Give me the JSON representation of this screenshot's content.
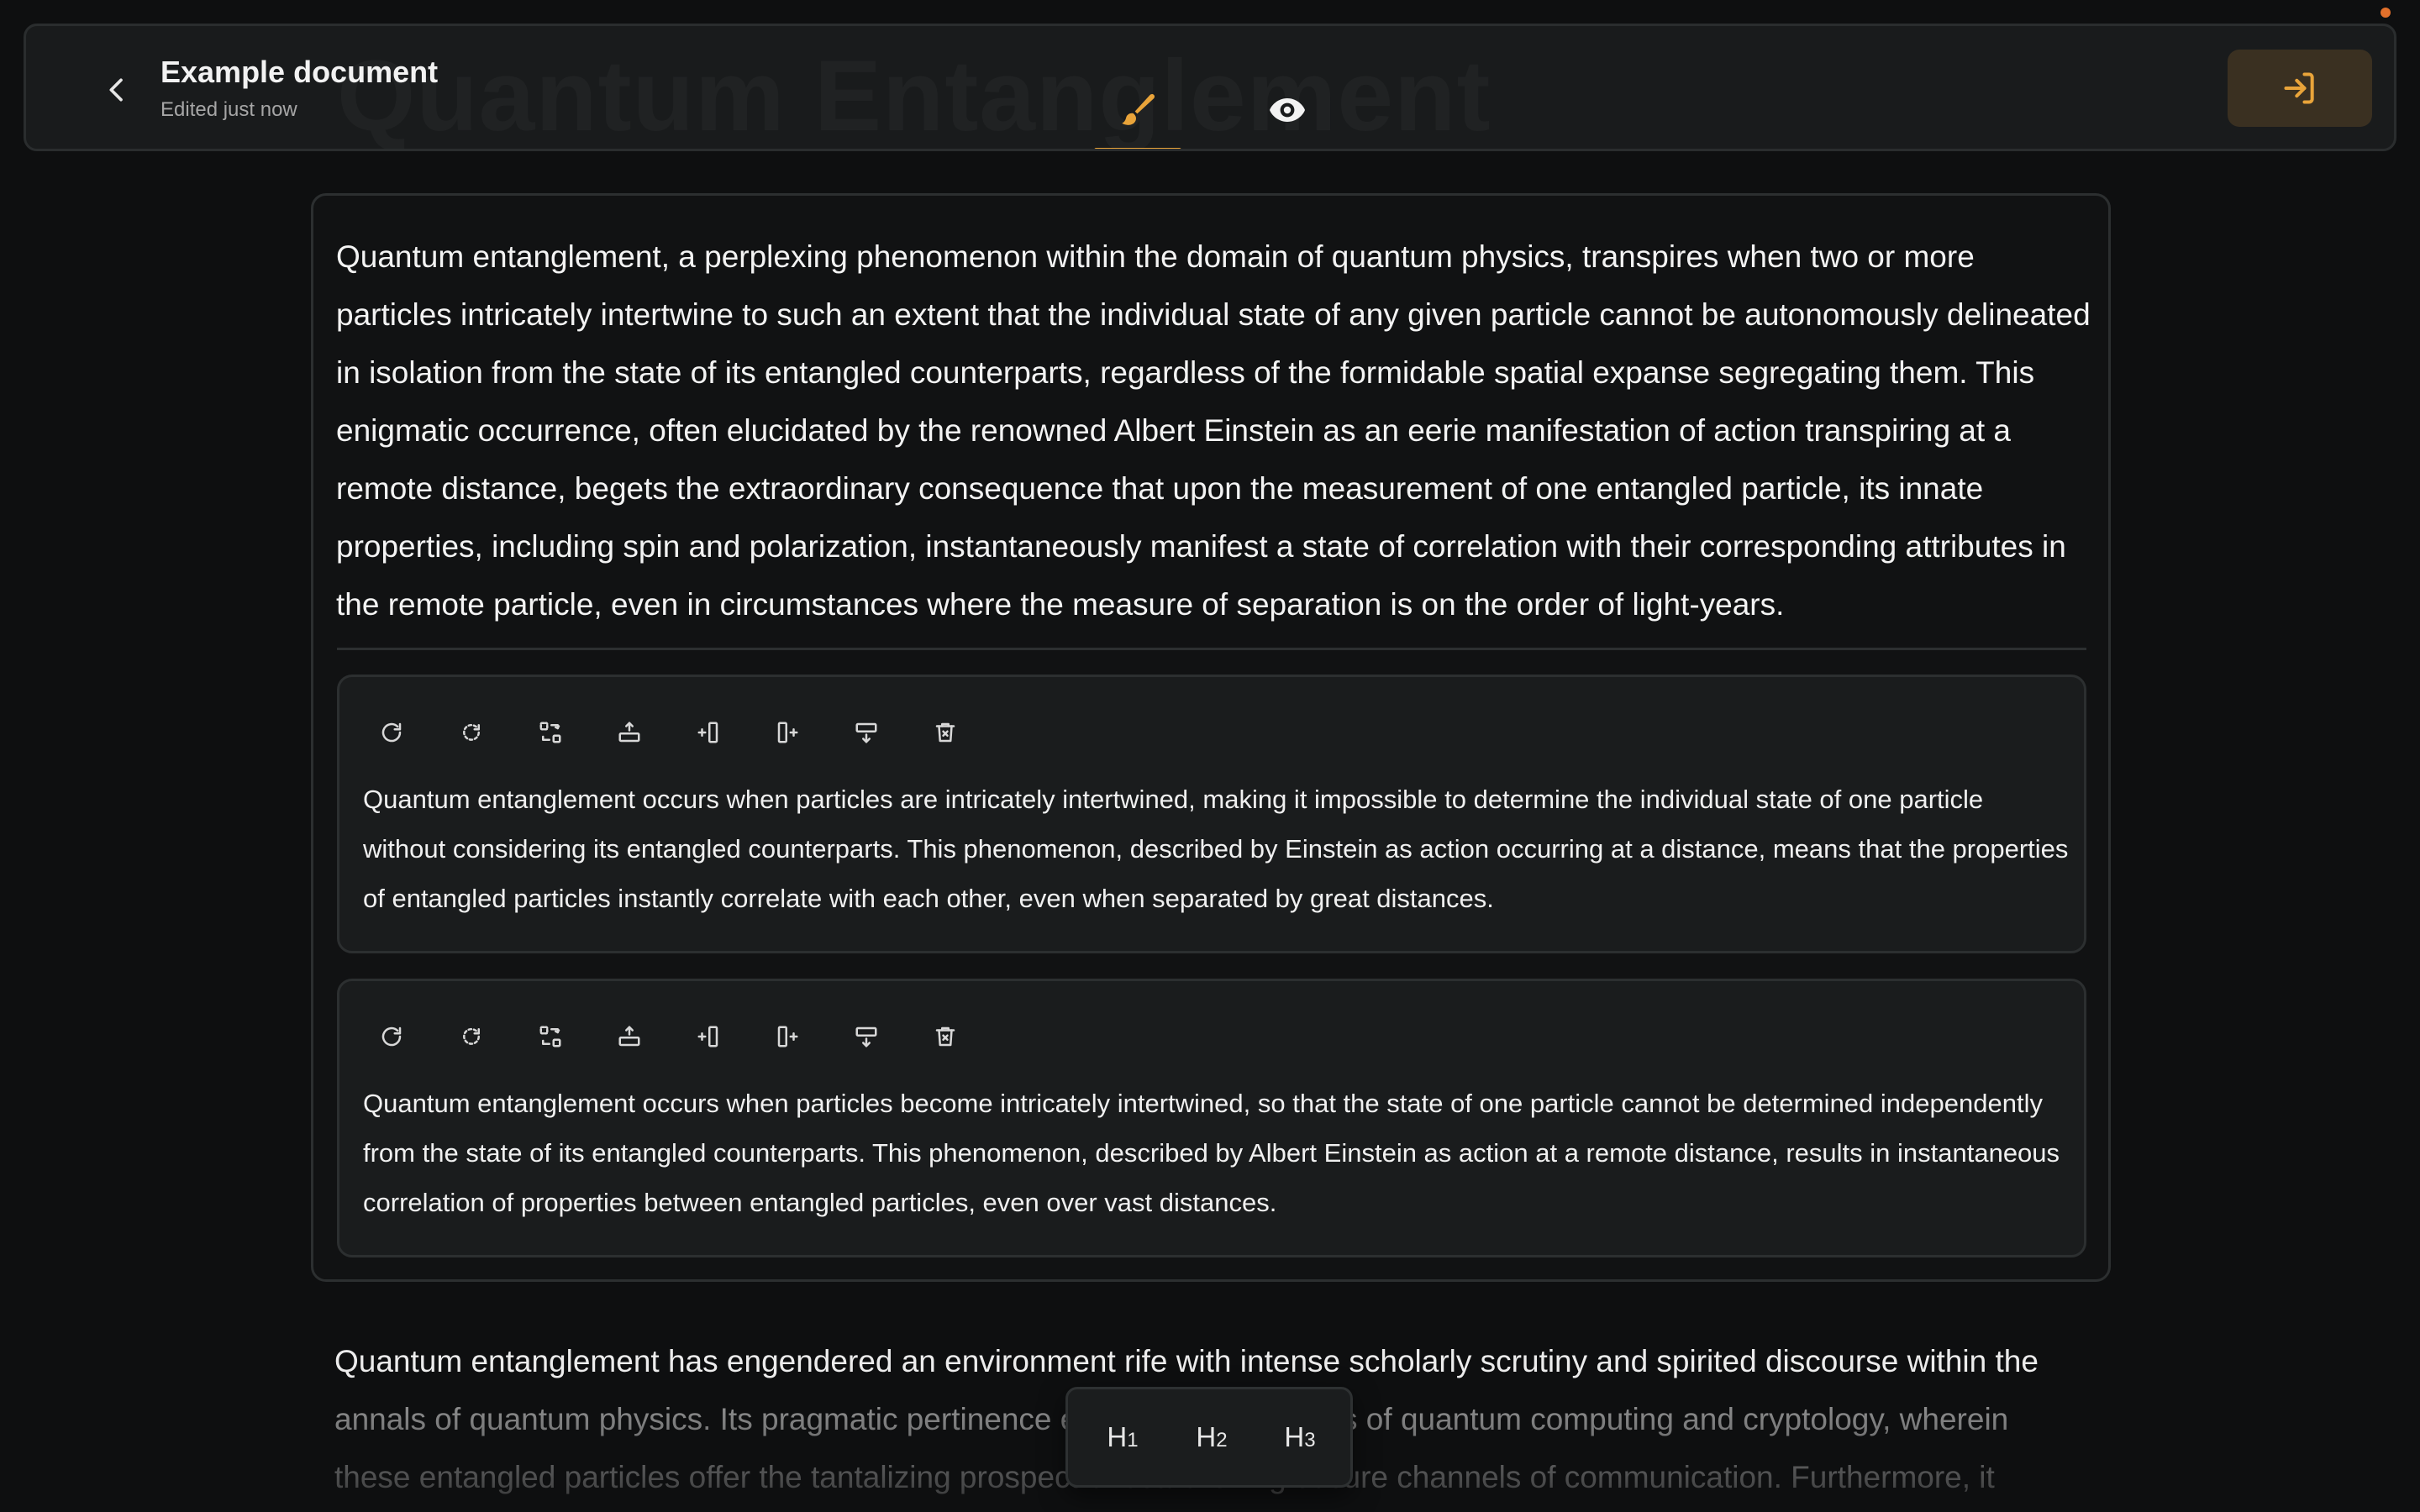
{
  "header": {
    "ghost_title": "Quantum Entanglement",
    "doc_title": "Example document",
    "doc_status": "Edited just now"
  },
  "main": {
    "paragraph": "Quantum entanglement, a perplexing phenomenon within the domain of quantum physics, transpires when two or more particles intricately intertwine to such an extent that the individual state of any given particle cannot be autonomously delineated in isolation from the state of its entangled counterparts, regardless of the formidable spatial expanse segregating them. This enigmatic occurrence, often elucidated by the renowned Albert Einstein as an eerie manifestation of action transpiring at a remote distance, begets the extraordinary consequence that upon the measurement of one entangled particle, its innate properties, including spin and polarization, instantaneously manifest a state of correlation with their corresponding attributes in the remote particle, even in circumstances where the measure of separation is on the order of light-years.",
    "suggestions": [
      {
        "text": "Quantum entanglement occurs when particles are intricately intertwined, making it impossible to determine the individual state of one particle without considering its entangled counterparts. This phenomenon, described by Einstein as action occurring at a distance, means that the properties of entangled particles instantly correlate with each other, even when separated by great distances."
      },
      {
        "text": "Quantum entanglement occurs when particles become intricately intertwined, so that the state of one particle cannot be determined independently from the state of its entangled counterparts. This phenomenon, described by Albert Einstein as action at a remote distance, results in instantaneous correlation of properties between entangled particles, even over vast distances."
      }
    ],
    "below_text": "Quantum entanglement has engendered an environment rife with intense scholarly scrutiny and spirited discourse within the annals of quantum physics. Its pragmatic pertinence extends to the realms of quantum computing and cryptology, wherein these entangled particles offer the tantalizing prospect of establishing secure channels of communication. Furthermore, it unflinchingly"
  },
  "heading_bar": {
    "h1": {
      "letter": "H",
      "digit": "1"
    },
    "h2": {
      "letter": "H",
      "digit": "2"
    },
    "h3": {
      "letter": "H",
      "digit": "3"
    }
  },
  "colors": {
    "background": "#0e0f10",
    "surface": "#191b1c",
    "accent": "#e9a43a",
    "publish_button_bg": "#3a3021",
    "status_dot": "#e2702b"
  },
  "icons": {
    "back": "chevron-left-icon",
    "edit_mode": "paintbrush-icon",
    "preview_mode": "eye-icon",
    "publish": "login-arrow-icon",
    "toolbar": [
      "regenerate-icon",
      "rephrase-icon",
      "replace-icon",
      "insert-above-icon",
      "insert-before-icon",
      "insert-after-icon",
      "insert-below-icon",
      "delete-icon"
    ]
  }
}
